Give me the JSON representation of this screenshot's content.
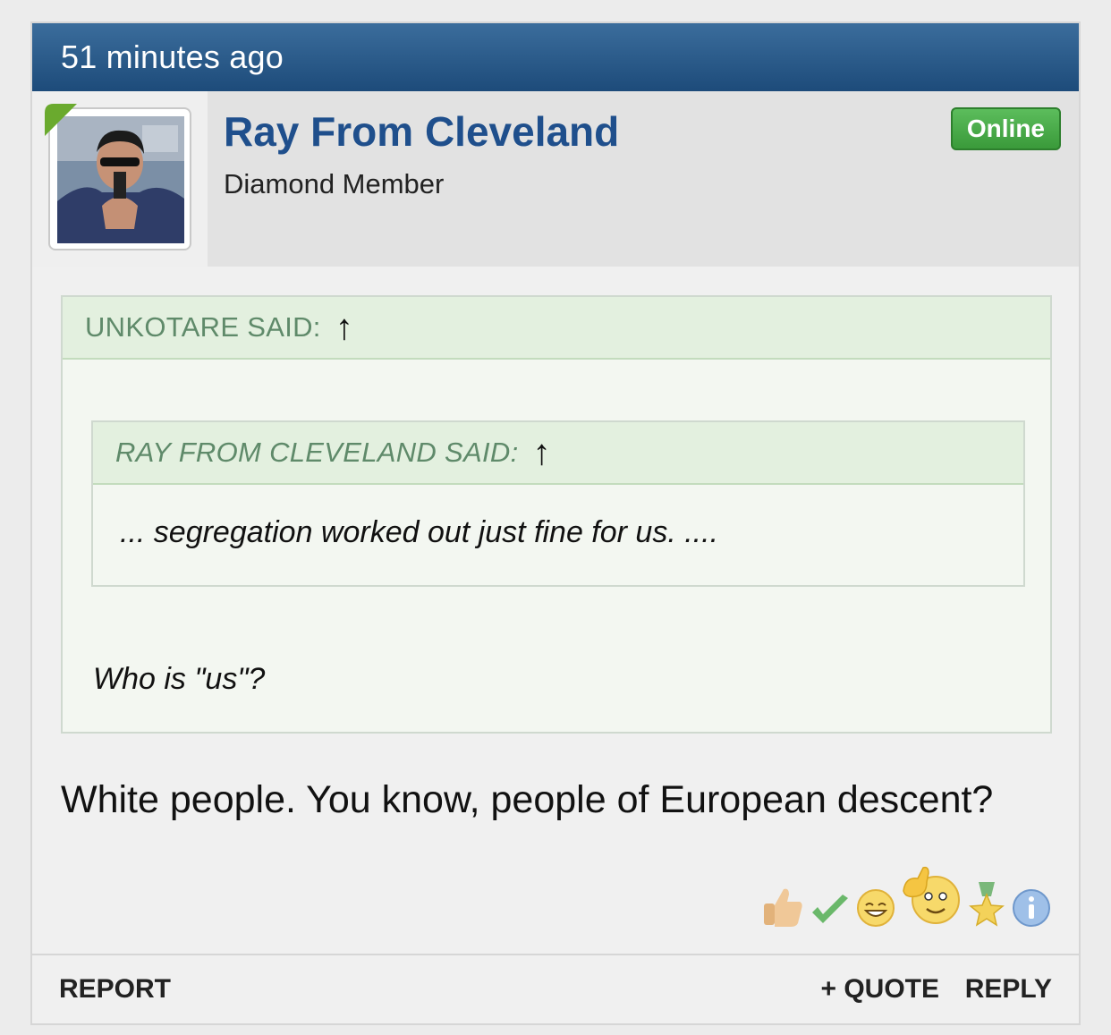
{
  "post": {
    "time_ago": "51 minutes ago",
    "user": {
      "name": "Ray From Cleveland",
      "title": "Diamond Member",
      "status": "Online"
    },
    "quote": {
      "author_label": "UNKOTARE SAID:",
      "arrow": "↑",
      "nested": {
        "author_label": "RAY FROM CLEVELAND SAID:",
        "arrow": "↑",
        "text": "... segregation worked out just fine for us. ...."
      },
      "text": "Who is \"us\"?"
    },
    "message": "White people. You know, people of European descent?",
    "reactions": [
      "thumbs-up-icon",
      "check-icon",
      "laugh-icon",
      "pointing-face-icon",
      "medal-icon",
      "info-icon"
    ],
    "footer": {
      "report": "REPORT",
      "quote": "+ QUOTE",
      "reply": "REPLY"
    }
  },
  "colors": {
    "header_blue": "#1d4b7a",
    "username_blue": "#1f4f8c",
    "online_green": "#3a9a3a",
    "quote_label_green": "#5f8a6a"
  }
}
